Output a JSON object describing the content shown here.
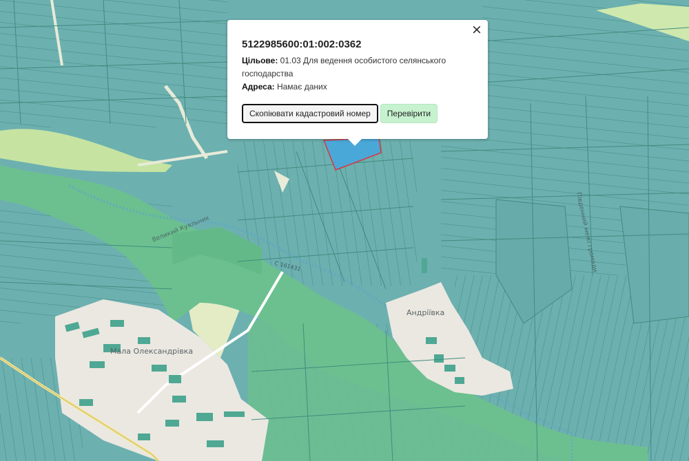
{
  "map": {
    "village_1": "Андріївка",
    "village_2": "Мала Олександрівка",
    "river": "Великий Куяльник",
    "road": "С 161431",
    "boundary": "Південний межі громади",
    "colors": {
      "parcel": "#6fb3b3",
      "parcel_dark": "#5ea3a5",
      "forest": "#6cc08f",
      "meadow": "#cde7a9",
      "settlement": "#ebe8e1",
      "selected": "#4aa8d8",
      "selected_border": "#d9363e"
    }
  },
  "popup": {
    "cadastral_number": "5122985600:01:002:0362",
    "purpose_label": "Цільове:",
    "purpose_value": "01.03 Для ведення особистого селянського господарства",
    "address_label": "Адреса:",
    "address_value": "Намає даних",
    "copy_button": "Скопіювати кадастровий номер",
    "check_button": "Перевірити",
    "close_icon": "×"
  }
}
